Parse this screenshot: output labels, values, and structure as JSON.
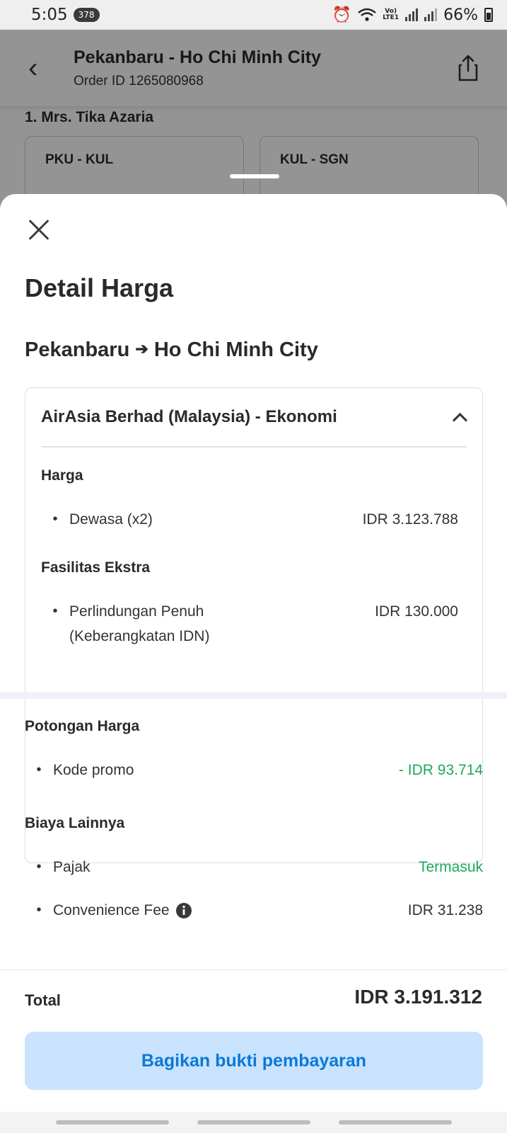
{
  "status": {
    "time": "5:05",
    "badge": "378",
    "battery": "66%"
  },
  "background": {
    "title": "Pekanbaru - Ho Chi Minh City",
    "order_id": "Order ID 1265080968",
    "passenger": "1.  Mrs. Tika Azaria",
    "segments": [
      "PKU - KUL",
      "KUL - SGN"
    ]
  },
  "sheet": {
    "title": "Detail Harga",
    "route_from": "Pekanbaru",
    "route_arrow": "➔",
    "route_to": "Ho Chi Minh City",
    "airline": "AirAsia Berhad (Malaysia) - Ekonomi",
    "harga_label": "Harga",
    "adult_label": "Dewasa (x2)",
    "adult_value": "IDR 3.123.788",
    "extra_label": "Fasilitas Ekstra",
    "extra_item_line1": "Perlindungan Penuh",
    "extra_item_line2": "(Keberangkatan IDN)",
    "extra_value": "IDR 130.000",
    "discount_label": "Potongan Harga",
    "promo_label": "Kode promo",
    "promo_value": "- IDR 93.714",
    "other_label": "Biaya Lainnya",
    "tax_label": "Pajak",
    "tax_value": "Termasuk",
    "fee_label": "Convenience Fee",
    "fee_value": "IDR 31.238",
    "total_label": "Total",
    "total_value": "IDR 3.191.312",
    "share_button": "Bagikan bukti pembayaran"
  },
  "colors": {
    "accent": "#0b79d6",
    "button_bg": "#c9e3ff",
    "positive": "#1ea85c"
  }
}
